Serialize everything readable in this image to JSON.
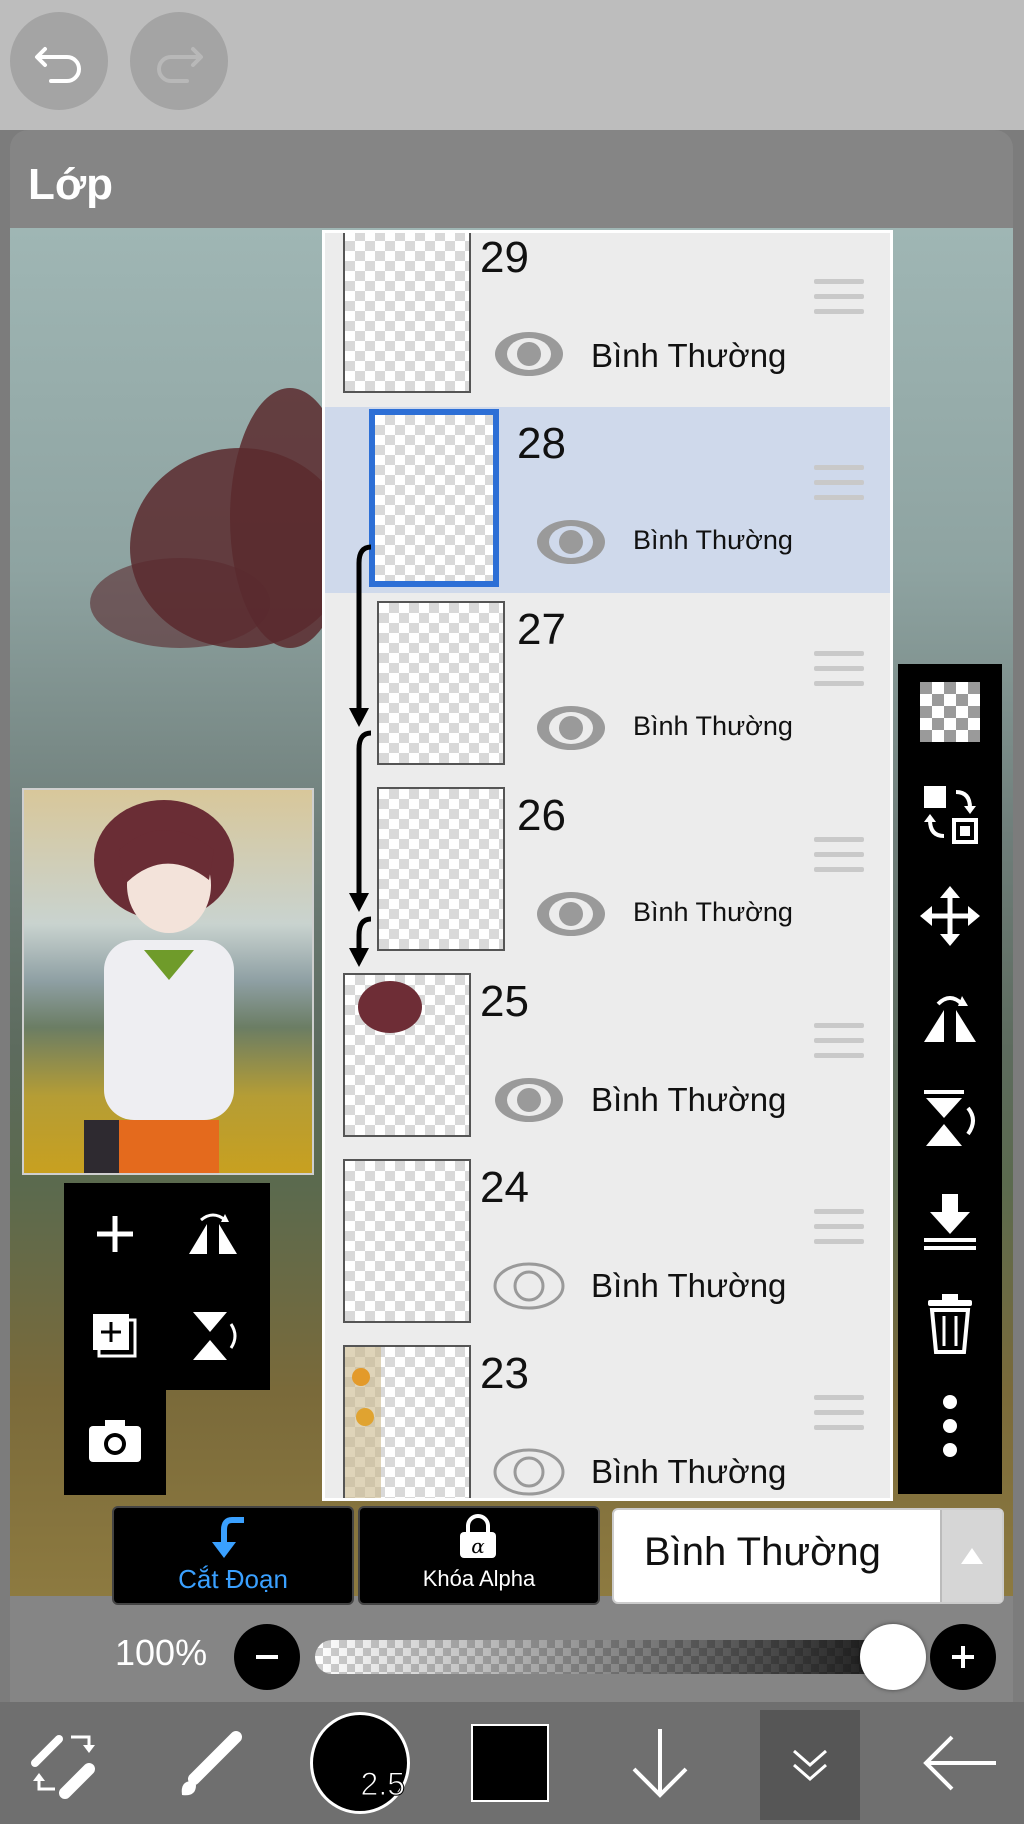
{
  "toolbar": {
    "undo_icon": "undo-icon",
    "redo_icon": "redo-icon"
  },
  "panel": {
    "title": "Lớp"
  },
  "layers": [
    {
      "number": "29",
      "mode": "Bình Thường",
      "visible": true,
      "selected": false
    },
    {
      "number": "28",
      "mode": "Bình Thường",
      "visible": true,
      "selected": true,
      "clipped": true
    },
    {
      "number": "27",
      "mode": "Bình Thường",
      "visible": true,
      "selected": false,
      "clipped": true
    },
    {
      "number": "26",
      "mode": "Bình Thường",
      "visible": true,
      "selected": false,
      "clipped": true
    },
    {
      "number": "25",
      "mode": "Bình Thường",
      "visible": true,
      "selected": false
    },
    {
      "number": "24",
      "mode": "Bình Thường",
      "visible": false,
      "selected": false
    },
    {
      "number": "23",
      "mode": "Bình Thường",
      "visible": false,
      "selected": false
    }
  ],
  "blend": {
    "clipping_label": "Cắt Đoạn",
    "alpha_lock_label": "Khóa Alpha",
    "mode_value": "Bình Thường"
  },
  "opacity": {
    "value_label": "100%",
    "value": 100
  },
  "bottom_toolbar": {
    "brush_size": "2.5",
    "color": "#000000"
  },
  "colors": {
    "selected_row": "#cfd9eb",
    "selected_border": "#2d6fd6",
    "clipping_accent": "#3aa0ff"
  }
}
